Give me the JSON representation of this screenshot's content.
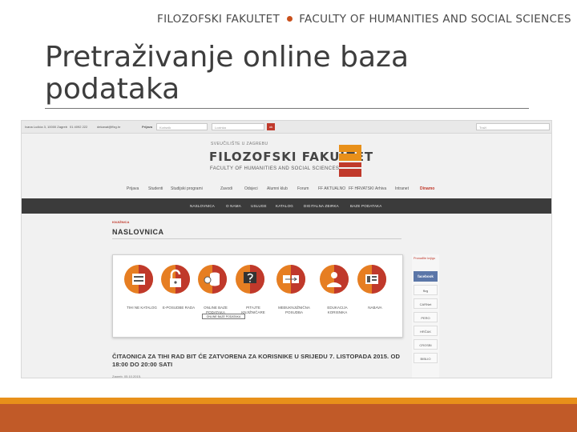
{
  "slide": {
    "header_left": "FILOZOFSKI FAKULTET",
    "header_right": "FACULTY OF HUMANITIES AND SOCIAL SCIENCES",
    "title": "Pretraživanje online baza podataka"
  },
  "site": {
    "topbar": {
      "address": "Ivana Lučića 3, 10000 Zagreb",
      "phone": "01 4092 222",
      "email": "dekanat@ffzg.hr",
      "login_label": "Prijava",
      "username_placeholder": "Korisnik",
      "password_placeholder": "Lozinka",
      "ok_label": "ok",
      "search_placeholder": "Traži"
    },
    "logo": {
      "sup": "SVEUČILIŠTE U ZAGREBU",
      "main": "FILOZOFSKI FAKULTET",
      "sub": "FACULTY OF HUMANITIES AND SOCIAL SCIENCES"
    },
    "main_nav": [
      "Prijava",
      "Studenti",
      "Studijski programi",
      "Zavodi",
      "Odsjeci",
      "Alumni klub",
      "Forum",
      "FF AKTUALNO",
      "FF HRVATSKI",
      "Arhiva",
      "Intranet",
      "Dinamo"
    ],
    "dark_nav": [
      "NASLOVNICA",
      "O NAMA",
      "USLUGE",
      "KATALOG",
      "DIGITALNA ZBIRKA",
      "BAZE PODATAKA"
    ],
    "breadcrumb": "KNJIŽNICA",
    "page_heading": "NASLOVNICA",
    "tiles": [
      {
        "label": "TIHI NE KATALOG",
        "icon": "catalog-icon"
      },
      {
        "label": "E-POSUDBE RADA",
        "icon": "lock-icon"
      },
      {
        "label": "ONLINE BAZE PODATAKA",
        "icon": "database-icon"
      },
      {
        "label": "PITAJTE KNJIŽNIČARE",
        "icon": "question-icon"
      },
      {
        "label": "MEĐUKNJIŽNIČNA POSUDBA",
        "icon": "exchange-icon"
      },
      {
        "label": "EDUKACIJA KORISNIKA",
        "icon": "education-icon"
      },
      {
        "label": "NABAVA",
        "icon": "purchase-icon"
      }
    ],
    "tooltip": "ONLINE BAZE PODATAKA",
    "sidebar": {
      "title": "Pronađite knjigu",
      "facebook": "facebook",
      "badges": [
        "ffzg",
        "CARNet",
        "PERO",
        "HRČAK",
        "CROSBI",
        "BIBLIO"
      ]
    },
    "news_title": "ČITAONICA ZA TIHI RAD BIT ĆE ZATVORENA ZA KORISNIKE U SRIJEDU 7. LISTOPADA 2015. OD 18:00 DO 20:00 SATI",
    "news_date": "Zagreb, 05.10.2015."
  },
  "colors": {
    "accent_orange": "#e8901a",
    "footer_rust": "#c15a28",
    "brand_red": "#c0392b",
    "tile_orange": "#e67e22",
    "dark_nav": "#3b3b3b"
  }
}
